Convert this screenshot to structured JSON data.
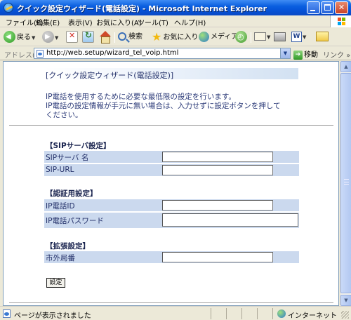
{
  "window": {
    "title": "クイック設定ウィザード(電話設定) - Microsoft Internet Explorer"
  },
  "menu": {
    "items": [
      "ファイル(F)",
      "編集(E)",
      "表示(V)",
      "お気に入り(A)",
      "ツール(T)",
      "ヘルプ(H)"
    ]
  },
  "toolbar": {
    "back_label": "戻る",
    "search_label": "検索",
    "favorites_label": "お気に入り",
    "media_label": "メディア"
  },
  "address": {
    "label": "アドレス(D)",
    "url": "http://web.setup/wizard_tel_voip.html",
    "go_label": "移動",
    "links_label": "リンク"
  },
  "page": {
    "title": "[クイック設定ウィザード(電話設定)]",
    "intro": [
      "IP電話を使用するために必要な最低限の設定を行います。",
      "IP電話の設定情報が手元に無い場合は、入力せずに設定ボタンを押して",
      "ください。"
    ],
    "sections": {
      "sip": {
        "title": "【SIPサーバ設定】",
        "rows": [
          {
            "label": "SIPサーバ 名",
            "value": ""
          },
          {
            "label": "SIP-URL",
            "value": ""
          }
        ]
      },
      "auth": {
        "title": "【認証用設定】",
        "rows": [
          {
            "label": "IP電話ID",
            "value": ""
          },
          {
            "label": "IP電話パスワード",
            "value": ""
          }
        ]
      },
      "ext": {
        "title": "【拡張設定】",
        "rows": [
          {
            "label": "市外局番",
            "value": ""
          }
        ]
      }
    },
    "submit_label": "設定"
  },
  "status": {
    "text": "ページが表示されました",
    "zone": "インターネット"
  },
  "colors": {
    "row_bg": "#cbd9ee",
    "text_blue": "#2b3a78",
    "titlebar": "#0a5fe0"
  }
}
